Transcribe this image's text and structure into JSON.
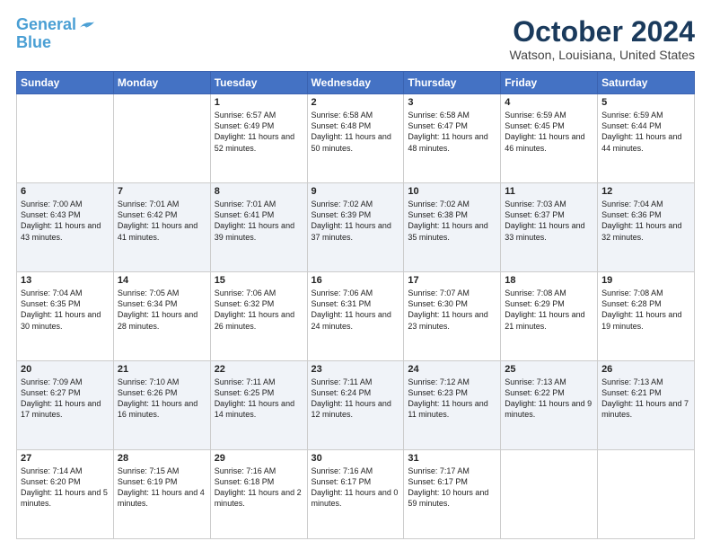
{
  "header": {
    "logo_line1": "General",
    "logo_line2": "Blue",
    "month_title": "October 2024",
    "location": "Watson, Louisiana, United States"
  },
  "days_of_week": [
    "Sunday",
    "Monday",
    "Tuesday",
    "Wednesday",
    "Thursday",
    "Friday",
    "Saturday"
  ],
  "weeks": [
    [
      {
        "day": "",
        "content": ""
      },
      {
        "day": "",
        "content": ""
      },
      {
        "day": "1",
        "content": "Sunrise: 6:57 AM\nSunset: 6:49 PM\nDaylight: 11 hours\nand 52 minutes."
      },
      {
        "day": "2",
        "content": "Sunrise: 6:58 AM\nSunset: 6:48 PM\nDaylight: 11 hours\nand 50 minutes."
      },
      {
        "day": "3",
        "content": "Sunrise: 6:58 AM\nSunset: 6:47 PM\nDaylight: 11 hours\nand 48 minutes."
      },
      {
        "day": "4",
        "content": "Sunrise: 6:59 AM\nSunset: 6:45 PM\nDaylight: 11 hours\nand 46 minutes."
      },
      {
        "day": "5",
        "content": "Sunrise: 6:59 AM\nSunset: 6:44 PM\nDaylight: 11 hours\nand 44 minutes."
      }
    ],
    [
      {
        "day": "6",
        "content": "Sunrise: 7:00 AM\nSunset: 6:43 PM\nDaylight: 11 hours\nand 43 minutes."
      },
      {
        "day": "7",
        "content": "Sunrise: 7:01 AM\nSunset: 6:42 PM\nDaylight: 11 hours\nand 41 minutes."
      },
      {
        "day": "8",
        "content": "Sunrise: 7:01 AM\nSunset: 6:41 PM\nDaylight: 11 hours\nand 39 minutes."
      },
      {
        "day": "9",
        "content": "Sunrise: 7:02 AM\nSunset: 6:39 PM\nDaylight: 11 hours\nand 37 minutes."
      },
      {
        "day": "10",
        "content": "Sunrise: 7:02 AM\nSunset: 6:38 PM\nDaylight: 11 hours\nand 35 minutes."
      },
      {
        "day": "11",
        "content": "Sunrise: 7:03 AM\nSunset: 6:37 PM\nDaylight: 11 hours\nand 33 minutes."
      },
      {
        "day": "12",
        "content": "Sunrise: 7:04 AM\nSunset: 6:36 PM\nDaylight: 11 hours\nand 32 minutes."
      }
    ],
    [
      {
        "day": "13",
        "content": "Sunrise: 7:04 AM\nSunset: 6:35 PM\nDaylight: 11 hours\nand 30 minutes."
      },
      {
        "day": "14",
        "content": "Sunrise: 7:05 AM\nSunset: 6:34 PM\nDaylight: 11 hours\nand 28 minutes."
      },
      {
        "day": "15",
        "content": "Sunrise: 7:06 AM\nSunset: 6:32 PM\nDaylight: 11 hours\nand 26 minutes."
      },
      {
        "day": "16",
        "content": "Sunrise: 7:06 AM\nSunset: 6:31 PM\nDaylight: 11 hours\nand 24 minutes."
      },
      {
        "day": "17",
        "content": "Sunrise: 7:07 AM\nSunset: 6:30 PM\nDaylight: 11 hours\nand 23 minutes."
      },
      {
        "day": "18",
        "content": "Sunrise: 7:08 AM\nSunset: 6:29 PM\nDaylight: 11 hours\nand 21 minutes."
      },
      {
        "day": "19",
        "content": "Sunrise: 7:08 AM\nSunset: 6:28 PM\nDaylight: 11 hours\nand 19 minutes."
      }
    ],
    [
      {
        "day": "20",
        "content": "Sunrise: 7:09 AM\nSunset: 6:27 PM\nDaylight: 11 hours\nand 17 minutes."
      },
      {
        "day": "21",
        "content": "Sunrise: 7:10 AM\nSunset: 6:26 PM\nDaylight: 11 hours\nand 16 minutes."
      },
      {
        "day": "22",
        "content": "Sunrise: 7:11 AM\nSunset: 6:25 PM\nDaylight: 11 hours\nand 14 minutes."
      },
      {
        "day": "23",
        "content": "Sunrise: 7:11 AM\nSunset: 6:24 PM\nDaylight: 11 hours\nand 12 minutes."
      },
      {
        "day": "24",
        "content": "Sunrise: 7:12 AM\nSunset: 6:23 PM\nDaylight: 11 hours\nand 11 minutes."
      },
      {
        "day": "25",
        "content": "Sunrise: 7:13 AM\nSunset: 6:22 PM\nDaylight: 11 hours\nand 9 minutes."
      },
      {
        "day": "26",
        "content": "Sunrise: 7:13 AM\nSunset: 6:21 PM\nDaylight: 11 hours\nand 7 minutes."
      }
    ],
    [
      {
        "day": "27",
        "content": "Sunrise: 7:14 AM\nSunset: 6:20 PM\nDaylight: 11 hours\nand 5 minutes."
      },
      {
        "day": "28",
        "content": "Sunrise: 7:15 AM\nSunset: 6:19 PM\nDaylight: 11 hours\nand 4 minutes."
      },
      {
        "day": "29",
        "content": "Sunrise: 7:16 AM\nSunset: 6:18 PM\nDaylight: 11 hours\nand 2 minutes."
      },
      {
        "day": "30",
        "content": "Sunrise: 7:16 AM\nSunset: 6:17 PM\nDaylight: 11 hours\nand 0 minutes."
      },
      {
        "day": "31",
        "content": "Sunrise: 7:17 AM\nSunset: 6:17 PM\nDaylight: 10 hours\nand 59 minutes."
      },
      {
        "day": "",
        "content": ""
      },
      {
        "day": "",
        "content": ""
      }
    ]
  ]
}
